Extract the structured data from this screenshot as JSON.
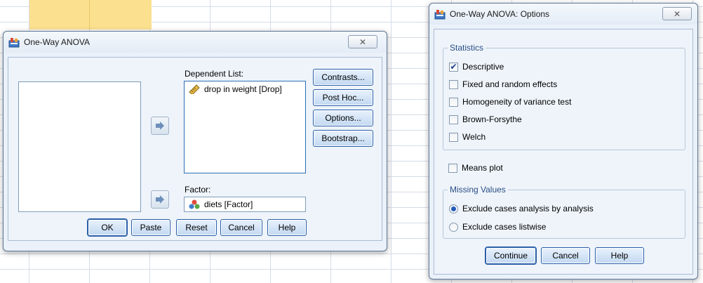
{
  "anova_dialog": {
    "title": "One-Way ANOVA",
    "close_label": "✕",
    "dependent_list_label": "Dependent List:",
    "dependent_items": [
      {
        "label": "drop in weight [Drop]",
        "icon": "ruler-icon"
      }
    ],
    "factor_label": "Factor:",
    "factor_value": "diets [Factor]",
    "side_buttons": [
      "Contrasts...",
      "Post Hoc...",
      "Options...",
      "Bootstrap..."
    ],
    "bottom_buttons": [
      "OK",
      "Paste",
      "Reset",
      "Cancel",
      "Help"
    ]
  },
  "options_dialog": {
    "title": "One-Way ANOVA: Options",
    "close_label": "✕",
    "statistics_title": "Statistics",
    "statistics": [
      {
        "label": "Descriptive",
        "checked": true
      },
      {
        "label": "Fixed and random effects",
        "checked": false
      },
      {
        "label": "Homogeneity of variance test",
        "checked": false
      },
      {
        "label": "Brown-Forsythe",
        "checked": false
      },
      {
        "label": "Welch",
        "checked": false
      }
    ],
    "means_plot": {
      "label": "Means plot",
      "checked": false
    },
    "missing_title": "Missing Values",
    "missing_options": [
      {
        "label": "Exclude cases analysis by analysis",
        "selected": true
      },
      {
        "label": "Exclude cases listwise",
        "selected": false
      }
    ],
    "buttons": [
      "Continue",
      "Cancel",
      "Help"
    ]
  },
  "colors": {
    "accent": "#2a5ea8",
    "group_title": "#2b4e85",
    "highlight_cell": "#fbe08f"
  }
}
